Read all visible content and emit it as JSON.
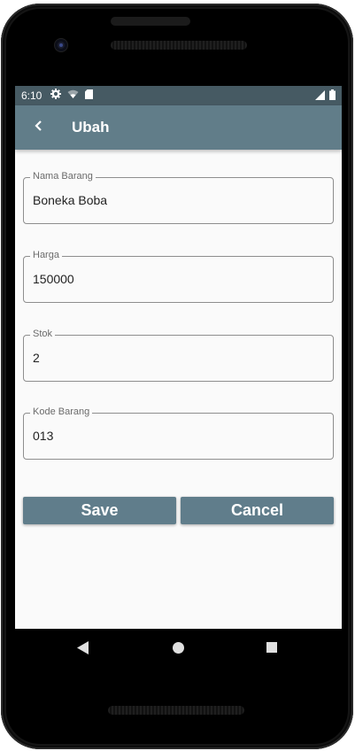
{
  "status_bar": {
    "time": "6:10",
    "icons_left": [
      "gear-icon",
      "wifi-icon",
      "sd-card-icon"
    ],
    "icons_right": [
      "signal-icon",
      "battery-icon"
    ]
  },
  "app_bar": {
    "title": "Ubah",
    "background": "#617d89",
    "back_icon": "chevron-left-icon"
  },
  "form": {
    "fields": [
      {
        "label": "Nama Barang",
        "value": "Boneka Boba"
      },
      {
        "label": "Harga",
        "value": "150000"
      },
      {
        "label": "Stok",
        "value": "2"
      },
      {
        "label": "Kode Barang",
        "value": "013"
      }
    ]
  },
  "actions": {
    "save_label": "Save",
    "cancel_label": "Cancel",
    "button_color": "#607d8b"
  },
  "nav_bar": {
    "icons": [
      "triangle-back-icon",
      "circle-home-icon",
      "square-recents-icon"
    ]
  }
}
